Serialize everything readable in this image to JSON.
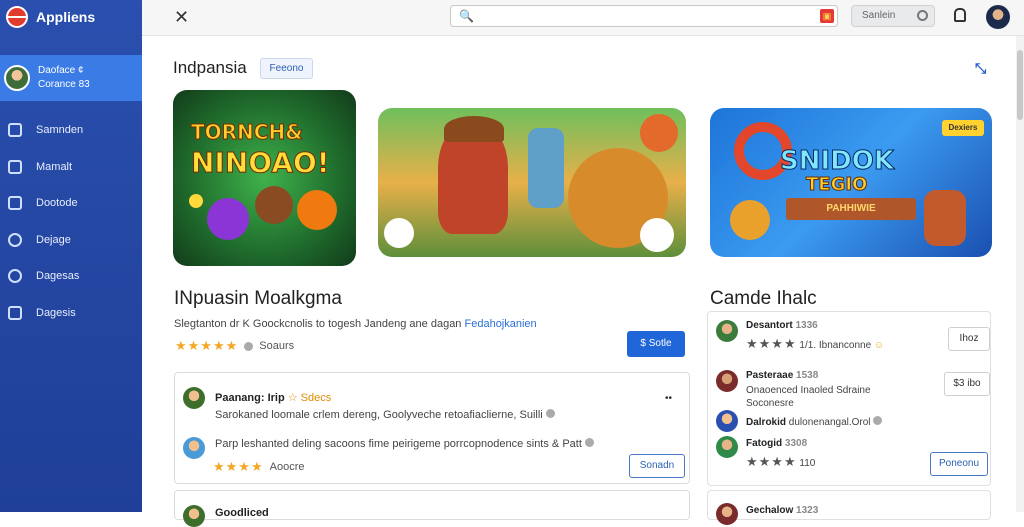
{
  "app": {
    "name": "Appliens"
  },
  "profile": {
    "line1": "Daoface ¢",
    "line2": "Corance 83"
  },
  "sidebar": {
    "items": [
      {
        "label": "Samnden",
        "icon": "box-icon"
      },
      {
        "label": "Mamalt",
        "icon": "chart-icon"
      },
      {
        "label": "Dootode",
        "icon": "list-icon"
      },
      {
        "label": "Dejage",
        "icon": "compass-icon"
      },
      {
        "label": "Dagesas",
        "icon": "gear-icon"
      },
      {
        "label": "Dagesis",
        "icon": "chat-icon"
      }
    ]
  },
  "topbar": {
    "search_value": "",
    "signin_label": "Sanlein"
  },
  "section": {
    "title": "Indpansia",
    "tag": "Feeono"
  },
  "cards": {
    "card1": {
      "line1": "TORNCH&",
      "line2": "NINOAO!"
    },
    "card3": {
      "line1": "SNIDOK",
      "line2": "TEGIO",
      "ribbon": "PAHHIWIE",
      "badge": "Dexiers"
    }
  },
  "featured": {
    "title": "INpuasin Moalkgma",
    "desc": "Slegtanton dr K Goockcnolis to togesh Jandeng ane dagan",
    "desc_link": "Fedahojkanien",
    "stars": "★★★★★",
    "rating_label": "Soaurs",
    "install_label": "$ Sotle"
  },
  "reviews": [
    {
      "name": "Paanang: Irip",
      "badge": "☆ Sdecs",
      "text": "Sarokaned loomale crlem dereng, Goolyveche retoafiaclierne, Suilli",
      "more": "••"
    },
    {
      "name": "",
      "badge": "",
      "text": "Parp leshanted deling sacoons fime peirigeme porrcopnodence sints & Patt"
    }
  ],
  "review_footer": {
    "stars": "★★★★",
    "label": "Aoocre",
    "button": "Sonadn"
  },
  "right": {
    "title": "Camde Ihalc",
    "items": [
      {
        "name": "Desantort",
        "meta": "1336",
        "stars": "★★★★",
        "note": "1/1. Ibnanconne",
        "button": "Ihoz"
      },
      {
        "name": "Pasteraae",
        "meta": "1538",
        "line2": "Onaoenced Inaoled Sdraine",
        "line3": "Soconesre",
        "button": "$3 ibo"
      },
      {
        "name": "Dalrokid",
        "meta": "",
        "note": "dulonenangal.Orol"
      },
      {
        "name": "Fatogid",
        "meta": "3308",
        "stars": "★★★★",
        "note": "110",
        "button": "Poneonu"
      }
    ]
  },
  "bottom_row": {
    "left_name": "Goodliced",
    "right_name": "Gechalow",
    "right_meta": "1323"
  }
}
